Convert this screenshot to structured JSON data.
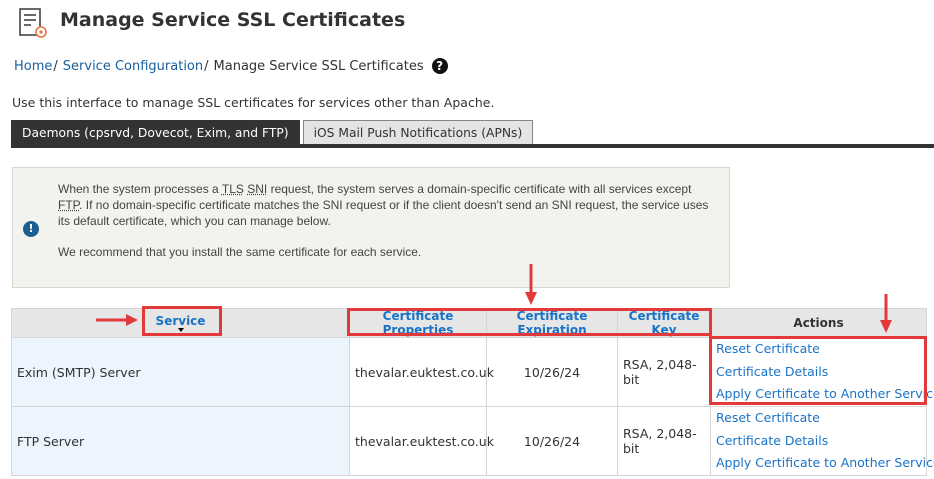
{
  "header": {
    "title": "Manage Service SSL Certificates",
    "icon": "certificate-doc-icon"
  },
  "breadcrumb": {
    "home": "Home",
    "section": "Service Configuration",
    "current": "Manage Service SSL Certificates",
    "separator": "/",
    "help_glyph": "?"
  },
  "intro": "Use this interface to manage SSL certificates for services other than Apache.",
  "tabs": [
    {
      "label": "Daemons (cpsrvd, Dovecot, Exim, and FTP)",
      "active": true
    },
    {
      "label": "iOS Mail Push Notifications (APNs)",
      "active": false
    }
  ],
  "info_box": {
    "icon_glyph": "!",
    "p1_a": "When the system processes a ",
    "tls": "TLS",
    "sni": "SNI",
    "p1_b": " request, the system serves a domain-specific certificate with all services except ",
    "ftp": "FTP",
    "p1_c": ". If no domain-specific certificate matches the SNI request or if the client doesn't send an SNI request, the service uses its default certificate, which you can manage below.",
    "p2": "We recommend that you install the same certificate for each service."
  },
  "table": {
    "headers": {
      "service": "Service",
      "cert_props": "Certificate Properties",
      "cert_exp": "Certificate Expiration",
      "cert_key": "Certificate Key",
      "actions": "Actions"
    },
    "rows": [
      {
        "service": "Exim (SMTP) Server",
        "domain": "thevalar.euktest.co.uk",
        "expiration": "10/26/24",
        "key": "RSA, 2,048-bit",
        "actions": [
          "Reset Certificate",
          "Certificate Details",
          "Apply Certificate to Another Service"
        ]
      },
      {
        "service": "FTP Server",
        "domain": "thevalar.euktest.co.uk",
        "expiration": "10/26/24",
        "key": "RSA, 2,048-bit",
        "actions": [
          "Reset Certificate",
          "Certificate Details",
          "Apply Certificate to Another Service"
        ]
      }
    ]
  },
  "colors": {
    "link": "#1a73c7",
    "annotation": "#e23a3a",
    "tab_active": "#333333",
    "service_cell": "#ecf4fd"
  }
}
